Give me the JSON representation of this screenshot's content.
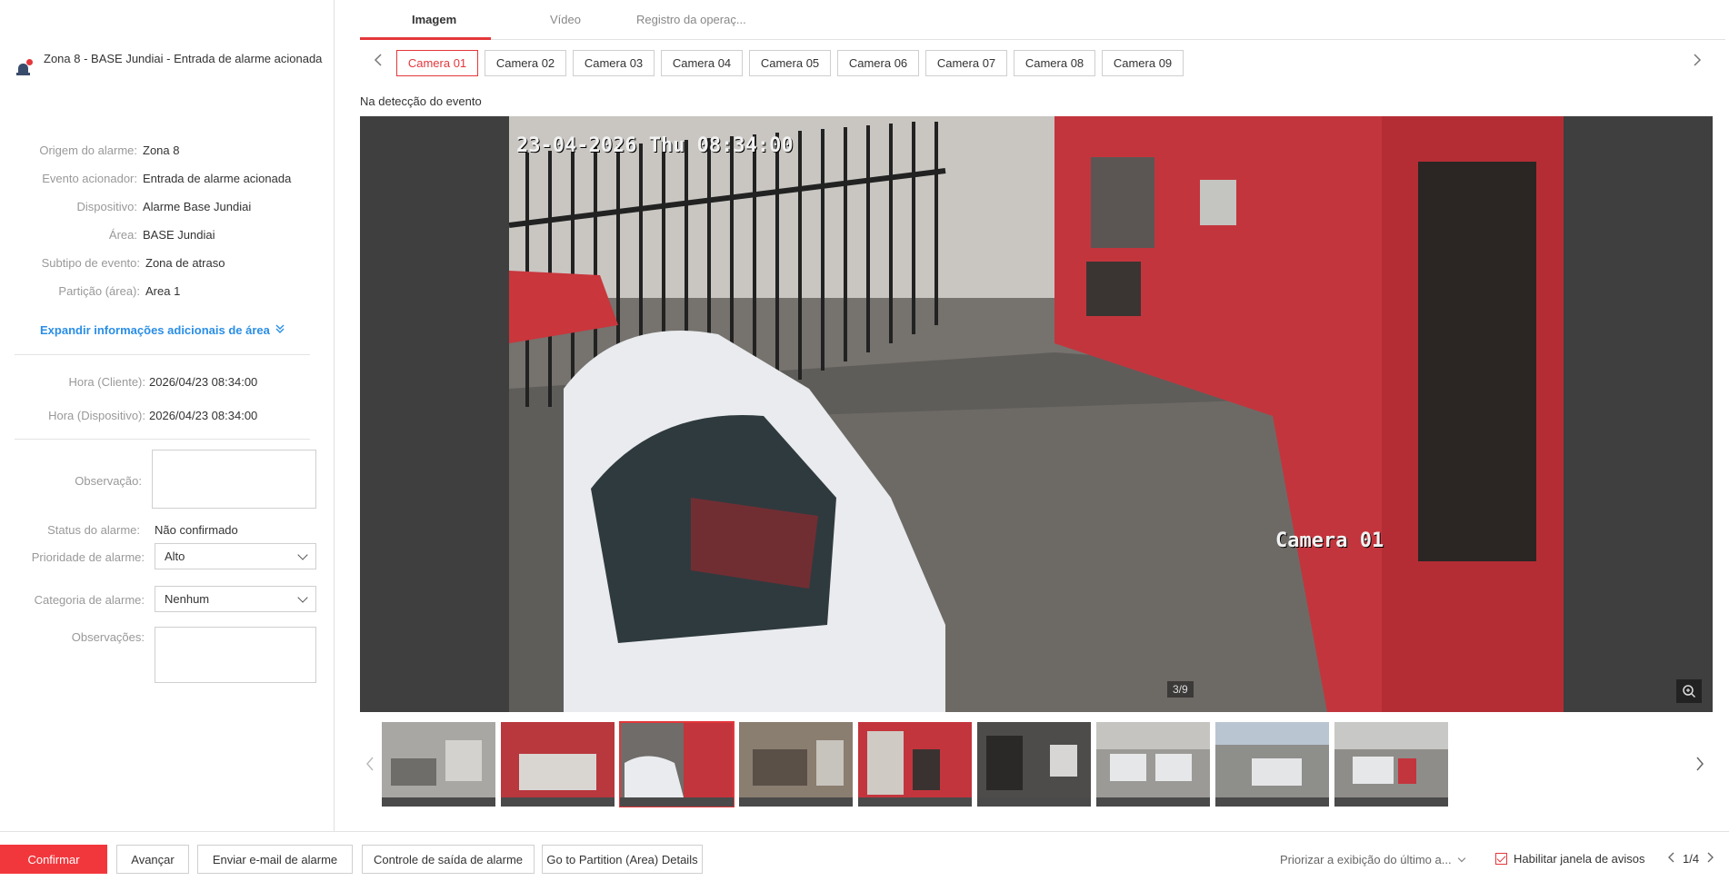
{
  "alarm": {
    "title": "Zona 8 - BASE Jundiai - Entrada de alarme acionada"
  },
  "details": [
    {
      "label": "Origem do alarme:",
      "value": "Zona 8"
    },
    {
      "label": "Evento acionador:",
      "value": "Entrada de alarme acionada"
    },
    {
      "label": "Dispositivo:",
      "value": "Alarme Base Jundiai"
    },
    {
      "label": "Área:",
      "value": "BASE Jundiai"
    },
    {
      "label": "Subtipo de evento:",
      "value": "Zona de atraso"
    },
    {
      "label": "Partição (área):",
      "value": "Area 1"
    }
  ],
  "expand_label": "Expandir informações adicionais de área",
  "times": [
    {
      "label": "Hora (Cliente):",
      "value": "2026/04/23 08:34:00"
    },
    {
      "label": "Hora (Dispositivo):",
      "value": "2026/04/23 08:34:00"
    }
  ],
  "form": {
    "observacao_label": "Observação:",
    "status_label": "Status do alarme:",
    "status_value": "Não confirmado",
    "prioridade_label": "Prioridade de alarme:",
    "prioridade_value": "Alto",
    "categoria_label": "Categoria de alarme:",
    "categoria_value": "Nenhum",
    "observacoes_label": "Observações:"
  },
  "tabs": [
    "Imagem",
    "Vídeo",
    "Registro da operaç..."
  ],
  "active_tab": 0,
  "cameras": [
    "Camera 01",
    "Camera 02",
    "Camera 03",
    "Camera 04",
    "Camera 05",
    "Camera 06",
    "Camera 07",
    "Camera 08",
    "Camera 09"
  ],
  "active_camera": 0,
  "event_label": "Na detecção do evento",
  "osd": {
    "timestamp": "23-04-2026 Thu 08:34:00",
    "camera_name": "Camera 01"
  },
  "image_counter": "3/9",
  "thumbnails_count": 9,
  "active_thumbnail": 2,
  "bottom": {
    "confirm": "Confirmar",
    "advance": "Avançar",
    "email": "Enviar e-mail de alarme",
    "exit_control": "Controle de saída de alarme",
    "partition": "Go to Partition (Area) Details",
    "priority_select": "Priorizar a exibição do último a...",
    "enable_window": "Habilitar janela de avisos",
    "pager": "1/4"
  },
  "colors": {
    "accent": "#e4373b",
    "link": "#2a8ee6"
  }
}
